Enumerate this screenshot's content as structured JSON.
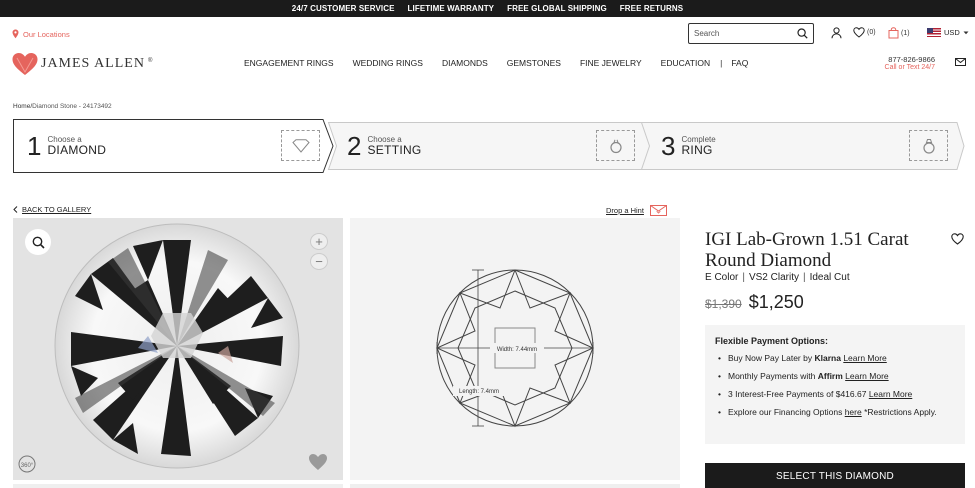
{
  "announcement": [
    "24/7 CUSTOMER SERVICE",
    "LIFETIME WARRANTY",
    "FREE GLOBAL SHIPPING",
    "FREE RETURNS"
  ],
  "header": {
    "locations_label": "Our Locations",
    "search_placeholder": "Search",
    "wishlist_count": "(0)",
    "cart_count": "(1)",
    "currency": "USD",
    "logo_text": "JAMES ALLEN",
    "logo_mark": "®",
    "phone": "877-826-9866",
    "call_text": "Call or Text 24/7"
  },
  "nav": {
    "items": [
      "ENGAGEMENT RINGS",
      "WEDDING RINGS",
      "DIAMONDS",
      "GEMSTONES",
      "FINE JEWELRY",
      "EDUCATION"
    ],
    "divider": "|",
    "faq": "FAQ"
  },
  "breadcrumb": {
    "home": "Home",
    "separator": "/",
    "current": "Diamond Stone - 24173492"
  },
  "steps": [
    {
      "number": "1",
      "small": "Choose a",
      "large": "DIAMOND",
      "icon": "diamond-icon"
    },
    {
      "number": "2",
      "small": "Choose a",
      "large": "SETTING",
      "icon": "ring-setting-icon"
    },
    {
      "number": "3",
      "small": "Complete",
      "large": "RING",
      "icon": "ring-icon"
    }
  ],
  "gallery": {
    "back_label": "BACK TO GALLERY",
    "hint_label": "Drop a Hint",
    "zoom_in": "+",
    "zoom_out": "−",
    "badge_360": "360°",
    "width_label": "Width: 7.44mm",
    "length_label": "Length: 7.4mm"
  },
  "product": {
    "title": "IGI Lab-Grown 1.51 Carat Round Diamond",
    "color": "E Color",
    "clarity": "VS2 Clarity",
    "cut": "Ideal Cut",
    "spec_sep": "|",
    "old_price": "$1,390",
    "price": "$1,250"
  },
  "payment": {
    "heading": "Flexible Payment Options:",
    "klarna_pre": "Buy Now Pay Later by ",
    "klarna_brand": "Klarna",
    "affirm_pre": "Monthly Payments with ",
    "affirm_brand": "Affirm",
    "installments_text": "3 Interest-Free Payments of $416.67",
    "financing_pre": "Explore our Financing Options ",
    "financing_link": "here",
    "financing_post": " *Restrictions Apply.",
    "learn_more": "Learn More"
  },
  "cta": {
    "select_label": "SELECT THIS DIAMOND"
  },
  "colors": {
    "accent": "#e5645d",
    "dark": "#1b1b1b",
    "panel": "#f4f4f4"
  }
}
